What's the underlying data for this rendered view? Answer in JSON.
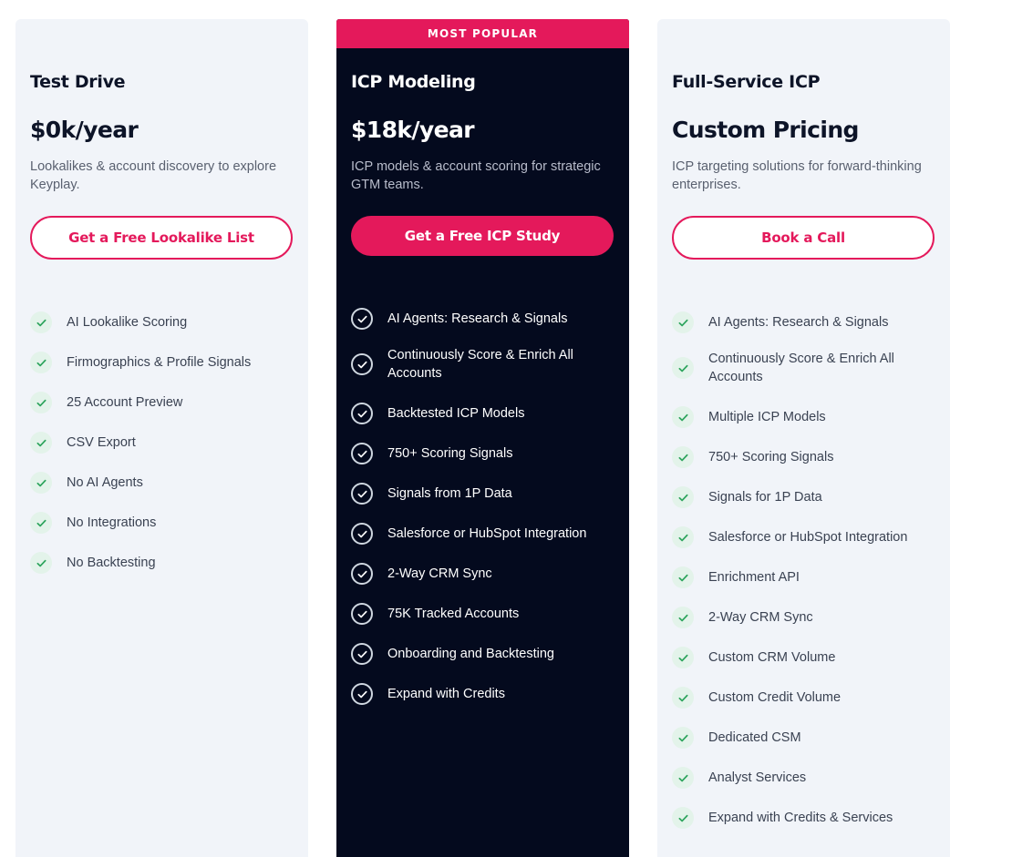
{
  "colors": {
    "accent": "#e4195b",
    "dark_card": "#040a1e",
    "light_card": "#f1f4f9",
    "check_green": "#2ca45c"
  },
  "plans": [
    {
      "name": "Test Drive",
      "price": "$0k/year",
      "description": "Lookalikes & account discovery to explore Keyplay.",
      "cta_label": "Get a Free Lookalike List",
      "features": [
        "AI Lookalike Scoring",
        "Firmographics & Profile Signals",
        "25 Account Preview",
        "CSV Export",
        "No AI Agents",
        "No Integrations",
        "No Backtesting"
      ]
    },
    {
      "badge": "MOST POPULAR",
      "name": "ICP Modeling",
      "price": "$18k/year",
      "description": "ICP models & account scoring for strategic GTM teams.",
      "cta_label": "Get a Free ICP Study",
      "features": [
        "AI Agents: Research & Signals",
        "Continuously Score & Enrich All Accounts",
        "Backtested ICP Models",
        "750+ Scoring Signals",
        "Signals from 1P Data",
        "Salesforce or HubSpot Integration",
        "2-Way CRM Sync",
        "75K Tracked Accounts",
        "Onboarding and Backtesting",
        "Expand with Credits"
      ]
    },
    {
      "name": "Full-Service ICP",
      "price": "Custom Pricing",
      "description": "ICP targeting solutions for forward-thinking enterprises.",
      "cta_label": "Book a Call",
      "features": [
        "AI Agents: Research & Signals",
        "Continuously Score & Enrich All Accounts",
        "Multiple ICP Models",
        "750+ Scoring Signals",
        "Signals for 1P Data",
        "Salesforce or HubSpot Integration",
        "Enrichment API",
        "2-Way CRM Sync",
        "Custom CRM Volume",
        "Custom Credit Volume",
        "Dedicated CSM",
        "Analyst Services",
        "Expand with Credits & Services"
      ]
    }
  ]
}
